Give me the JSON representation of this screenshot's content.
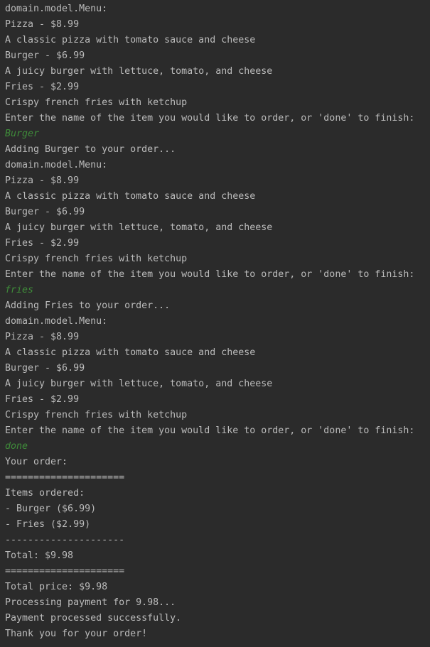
{
  "console": {
    "lines": [
      {
        "text": "domain.model.Menu:",
        "kind": "output"
      },
      {
        "text": "Pizza - $8.99",
        "kind": "output"
      },
      {
        "text": "A classic pizza with tomato sauce and cheese",
        "kind": "output"
      },
      {
        "text": "Burger - $6.99",
        "kind": "output"
      },
      {
        "text": "A juicy burger with lettuce, tomato, and cheese",
        "kind": "output"
      },
      {
        "text": "Fries - $2.99",
        "kind": "output"
      },
      {
        "text": "Crispy french fries with ketchup",
        "kind": "output"
      },
      {
        "text": "Enter the name of the item you would like to order, or 'done' to finish:",
        "kind": "output"
      },
      {
        "text": "Burger",
        "kind": "input"
      },
      {
        "text": "Adding Burger to your order...",
        "kind": "output"
      },
      {
        "text": "domain.model.Menu:",
        "kind": "output"
      },
      {
        "text": "Pizza - $8.99",
        "kind": "output"
      },
      {
        "text": "A classic pizza with tomato sauce and cheese",
        "kind": "output"
      },
      {
        "text": "Burger - $6.99",
        "kind": "output"
      },
      {
        "text": "A juicy burger with lettuce, tomato, and cheese",
        "kind": "output"
      },
      {
        "text": "Fries - $2.99",
        "kind": "output"
      },
      {
        "text": "Crispy french fries with ketchup",
        "kind": "output"
      },
      {
        "text": "Enter the name of the item you would like to order, or 'done' to finish:",
        "kind": "output"
      },
      {
        "text": "fries",
        "kind": "input"
      },
      {
        "text": "Adding Fries to your order...",
        "kind": "output"
      },
      {
        "text": "domain.model.Menu:",
        "kind": "output"
      },
      {
        "text": "Pizza - $8.99",
        "kind": "output"
      },
      {
        "text": "A classic pizza with tomato sauce and cheese",
        "kind": "output"
      },
      {
        "text": "Burger - $6.99",
        "kind": "output"
      },
      {
        "text": "A juicy burger with lettuce, tomato, and cheese",
        "kind": "output"
      },
      {
        "text": "Fries - $2.99",
        "kind": "output"
      },
      {
        "text": "Crispy french fries with ketchup",
        "kind": "output"
      },
      {
        "text": "Enter the name of the item you would like to order, or 'done' to finish:",
        "kind": "output"
      },
      {
        "text": "done",
        "kind": "input"
      },
      {
        "text": "Your order:",
        "kind": "output"
      },
      {
        "text": "=====================",
        "kind": "output"
      },
      {
        "text": "Items ordered:",
        "kind": "output"
      },
      {
        "text": "- Burger ($6.99)",
        "kind": "output"
      },
      {
        "text": "- Fries ($2.99)",
        "kind": "output"
      },
      {
        "text": "---------------------",
        "kind": "output"
      },
      {
        "text": "Total: $9.98",
        "kind": "output"
      },
      {
        "text": "=====================",
        "kind": "output"
      },
      {
        "text": "Total price: $9.98",
        "kind": "output"
      },
      {
        "text": "Processing payment for 9.98...",
        "kind": "output"
      },
      {
        "text": "Payment processed successfully.",
        "kind": "output"
      },
      {
        "text": "Thank you for your order!",
        "kind": "output"
      }
    ]
  },
  "colors": {
    "background": "#2b2b2b",
    "output_text": "#bbbbbb",
    "user_input_text": "#3f8c3a"
  }
}
